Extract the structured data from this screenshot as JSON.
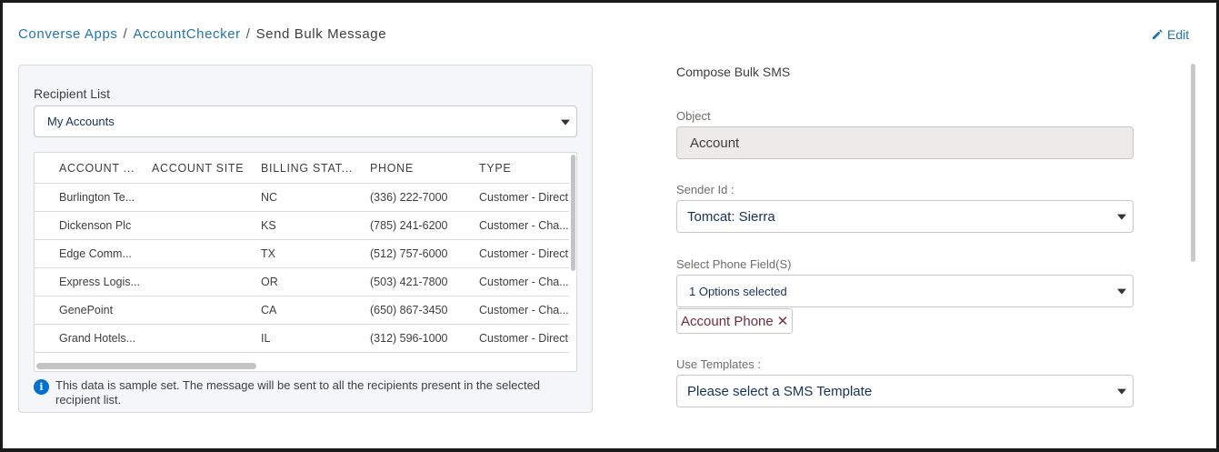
{
  "breadcrumb": {
    "items": [
      "Converse Apps",
      "AccountChecker"
    ],
    "separator": "/",
    "current": "Send Bulk Message"
  },
  "header": {
    "edit_label": "Edit",
    "edit_icon": "pencil-icon"
  },
  "recipient": {
    "label": "Recipient List",
    "selected": "My Accounts"
  },
  "table": {
    "columns": [
      "ACCOUNT ...",
      "ACCOUNT SITE",
      "BILLING STAT...",
      "PHONE",
      "TYPE"
    ],
    "rows": [
      [
        "Burlington Te...",
        "",
        "NC",
        "(336) 222-7000",
        "Customer - Direct"
      ],
      [
        "Dickenson Plc",
        "",
        "KS",
        "(785) 241-6200",
        "Customer - Cha..."
      ],
      [
        "Edge Comm...",
        "",
        "TX",
        "(512) 757-6000",
        "Customer - Direct"
      ],
      [
        "Express Logis...",
        "",
        "OR",
        "(503) 421-7800",
        "Customer - Cha..."
      ],
      [
        "GenePoint",
        "",
        "CA",
        "(650) 867-3450",
        "Customer - Cha..."
      ],
      [
        "Grand Hotels...",
        "",
        "IL",
        "(312) 596-1000",
        "Customer - Direct"
      ]
    ]
  },
  "note": {
    "icon": "info-icon",
    "text": "This data is sample set. The message will be sent to all the recipients present in the selected recipient list."
  },
  "compose": {
    "title": "Compose Bulk SMS",
    "object_label": "Object",
    "object_value": "Account",
    "sender_label": "Sender Id :",
    "sender_value": "Tomcat: Sierra",
    "phone_field_label": "Select Phone Field(S)",
    "phone_field_value": "1 Options selected",
    "phone_pill": "Account Phone",
    "template_label": "Use Templates :",
    "template_value": "Please select a SMS Template"
  },
  "colors": {
    "link": "#2574a9",
    "info": "#0070d2",
    "card_bg": "#f4f6f9"
  }
}
